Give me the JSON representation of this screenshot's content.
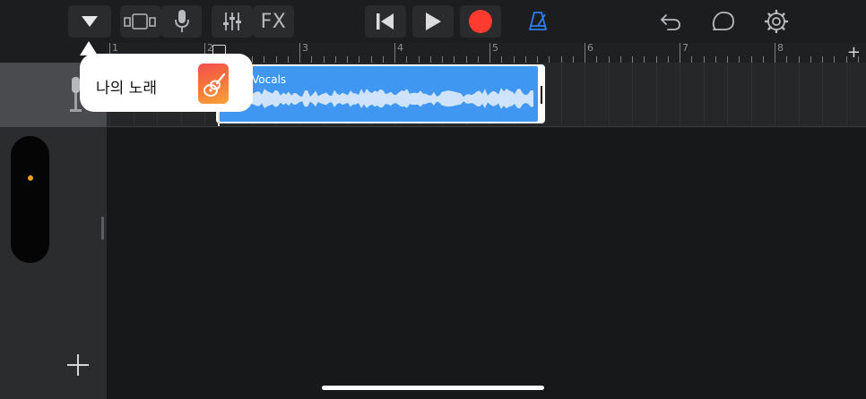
{
  "toolbar": {
    "fx_label": "FX"
  },
  "ruler": {
    "bars": [
      "1",
      "2",
      "3",
      "4",
      "5",
      "6",
      "7",
      "8"
    ]
  },
  "popover": {
    "song_title": "나의 노래"
  },
  "track": {
    "region_name": "Vocals"
  },
  "colors": {
    "accent_blue": "#3f97f1",
    "record_red": "#ff3b30",
    "metronome_blue": "#2f7cf6",
    "track_dot_orange": "#f2a019"
  },
  "icons": [
    "browser-toggle-icon",
    "tracks-view-icon",
    "microphone-icon",
    "mixer-sliders-icon",
    "go-to-beginning-icon",
    "play-icon",
    "record-icon",
    "metronome-icon",
    "undo-icon",
    "loop-browser-icon",
    "settings-gear-icon",
    "add-section-icon",
    "add-track-icon"
  ]
}
